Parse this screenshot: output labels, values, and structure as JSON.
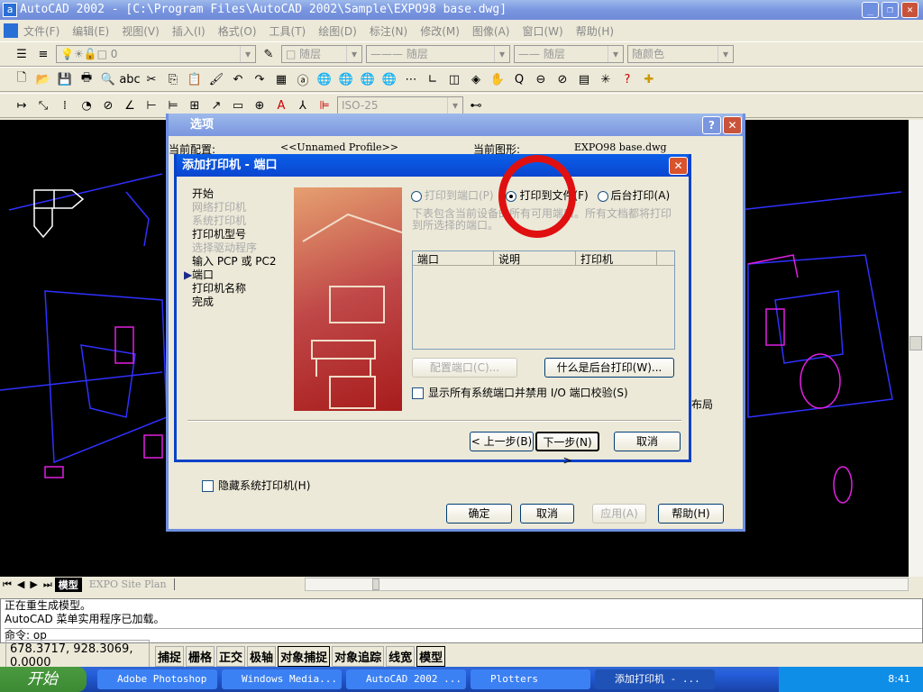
{
  "window": {
    "title": "AutoCAD 2002 - [C:\\Program Files\\AutoCAD 2002\\Sample\\EXPO98 base.dwg]",
    "app_icon": "autocad-icon"
  },
  "menu": [
    "文件(F)",
    "编辑(E)",
    "视图(V)",
    "插入(I)",
    "格式(O)",
    "工具(T)",
    "绘图(D)",
    "标注(N)",
    "修改(M)",
    "图像(A)",
    "窗口(W)",
    "帮助(H)"
  ],
  "properties_toolbar": {
    "layer": "0",
    "color": "随层",
    "linetype": "随层",
    "lineweight": "随层",
    "plotstyle": "随颜色"
  },
  "dim_toolbar": {
    "dimstyle": "ISO-25"
  },
  "layout_tabs": [
    "模型",
    "EXPO Site Plan"
  ],
  "command": {
    "lines": [
      "正在重生成模型。",
      "AutoCAD 菜单实用程序已加载。"
    ],
    "prompt": "命令: op"
  },
  "status": {
    "coords": "678.3717, 928.3069, 0.0000",
    "toggles": [
      "捕捉",
      "栅格",
      "正交",
      "极轴",
      "对象捕捉",
      "对象追踪",
      "线宽",
      "模型"
    ]
  },
  "taskbar": {
    "start": "开始",
    "tasks": [
      "Adobe Photoshop",
      "Windows Media...",
      "AutoCAD 2002 ...",
      "Plotters",
      "添加打印机 - ..."
    ],
    "clock": "8:41"
  },
  "options_dialog": {
    "title": "选项",
    "profile_label": "当前配置:",
    "profile_value": "<<Unnamed Profile>>",
    "drawing_label": "当前图形:",
    "drawing_value": "EXPO98 base.dwg",
    "hide_printers": "隐藏系统打印机(H)",
    "partial_text": "布局",
    "buttons": {
      "ok": "确定",
      "cancel": "取消",
      "apply": "应用(A)",
      "help": "帮助(H)"
    }
  },
  "wizard": {
    "title": "添加打印机 - 端口",
    "steps": [
      {
        "label": "开始",
        "state": "done"
      },
      {
        "label": "网络打印机",
        "state": "disabled"
      },
      {
        "label": "系统打印机",
        "state": "disabled"
      },
      {
        "label": "打印机型号",
        "state": "done"
      },
      {
        "label": "选择驱动程序",
        "state": "disabled"
      },
      {
        "label": "输入 PCP 或 PC2",
        "state": "done"
      },
      {
        "label": "端口",
        "state": "current"
      },
      {
        "label": "打印机名称",
        "state": "todo"
      },
      {
        "label": "完成",
        "state": "todo"
      }
    ],
    "radios": [
      {
        "label": "打印到端口(P)",
        "selected": false,
        "enabled": false
      },
      {
        "label": "打印到文件(F)",
        "selected": true,
        "enabled": true
      },
      {
        "label": "后台打印(A)",
        "selected": false,
        "enabled": true
      }
    ],
    "description": "下表包含当前设备的所有可用端口。所有文档都将打印到所选择的端口。",
    "columns": [
      "端口",
      "说明",
      "打印机"
    ],
    "configure_port": "配置端口(C)...",
    "what_is_spool": "什么是后台打印(W)...",
    "show_all_ports": "显示所有系统端口并禁用 I/O 端口校验(S)",
    "back": "< 上一步(B)",
    "next": "下一步(N) >",
    "cancel": "取消"
  },
  "annotation": {
    "color": "#e01010"
  }
}
